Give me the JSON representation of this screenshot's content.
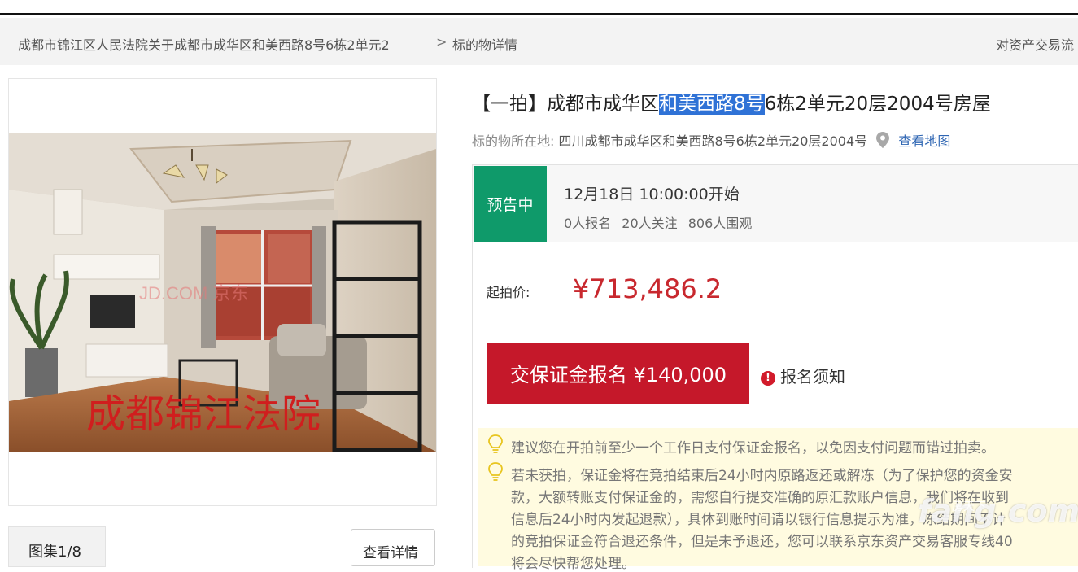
{
  "breadcrumb": {
    "item1": "成都市锦江区人民法院关于成都市成华区和美西路8号6栋2单元2",
    "separator": ">",
    "item2": "标的物详情",
    "right_link": "对资产交易流"
  },
  "gallery": {
    "watermark_text": "JD.COM 京东",
    "stamp_text": "成都锦江法院",
    "counter_label": "图集1/8",
    "detail_button": "查看详情"
  },
  "listing": {
    "title_before": "【一拍】成都市成华区",
    "title_highlight": "和美西路8号",
    "title_after": "6栋2单元20层2004号房屋",
    "location_label": "标的物所在地:",
    "location_value": "四川成都市成华区和美西路8号6栋2单元20层2004号",
    "map_link": "查看地图"
  },
  "status": {
    "badge": "预告中",
    "start_time": "12月18日 10:00:00开始",
    "registrants": "0人报名",
    "followers": "20人关注",
    "viewers": "806人围观"
  },
  "pricing": {
    "start_label": "起拍价:",
    "start_price": "¥713,486.2",
    "deposit_button": "交保证金报名 ¥140,000",
    "notice_link": "报名须知"
  },
  "tips": {
    "line1": "建议您在开拍前至少一个工作日支付保证金报名，以免因支付问题而错过拍卖。",
    "line2": "若未获拍，保证金将在竞拍结束后24小时内原路返还或解冻（为了保护您的资金安",
    "line3": "款，大额转账支付保证金的，需您自行提交准确的原汇款账户信息，我们将在收到",
    "line4": "信息后24小时内发起退款），具体到账时间请以银行信息提示为准，冻结期间不计",
    "line5": "的竞拍保证金符合退还条件，但是未予退还，您可以联系京东资产交易客服专线40",
    "line6": "将会尽快帮您处理。"
  },
  "site_watermark": {
    "brand": "fang.com",
    "small": "房天下"
  },
  "colors": {
    "accent_red": "#c5182a",
    "price_red": "#c8282e",
    "status_green": "#0f9a6a",
    "link_blue": "#2f66b3",
    "highlight_blue": "#2f72d6",
    "tips_bg": "#fffbe0"
  }
}
